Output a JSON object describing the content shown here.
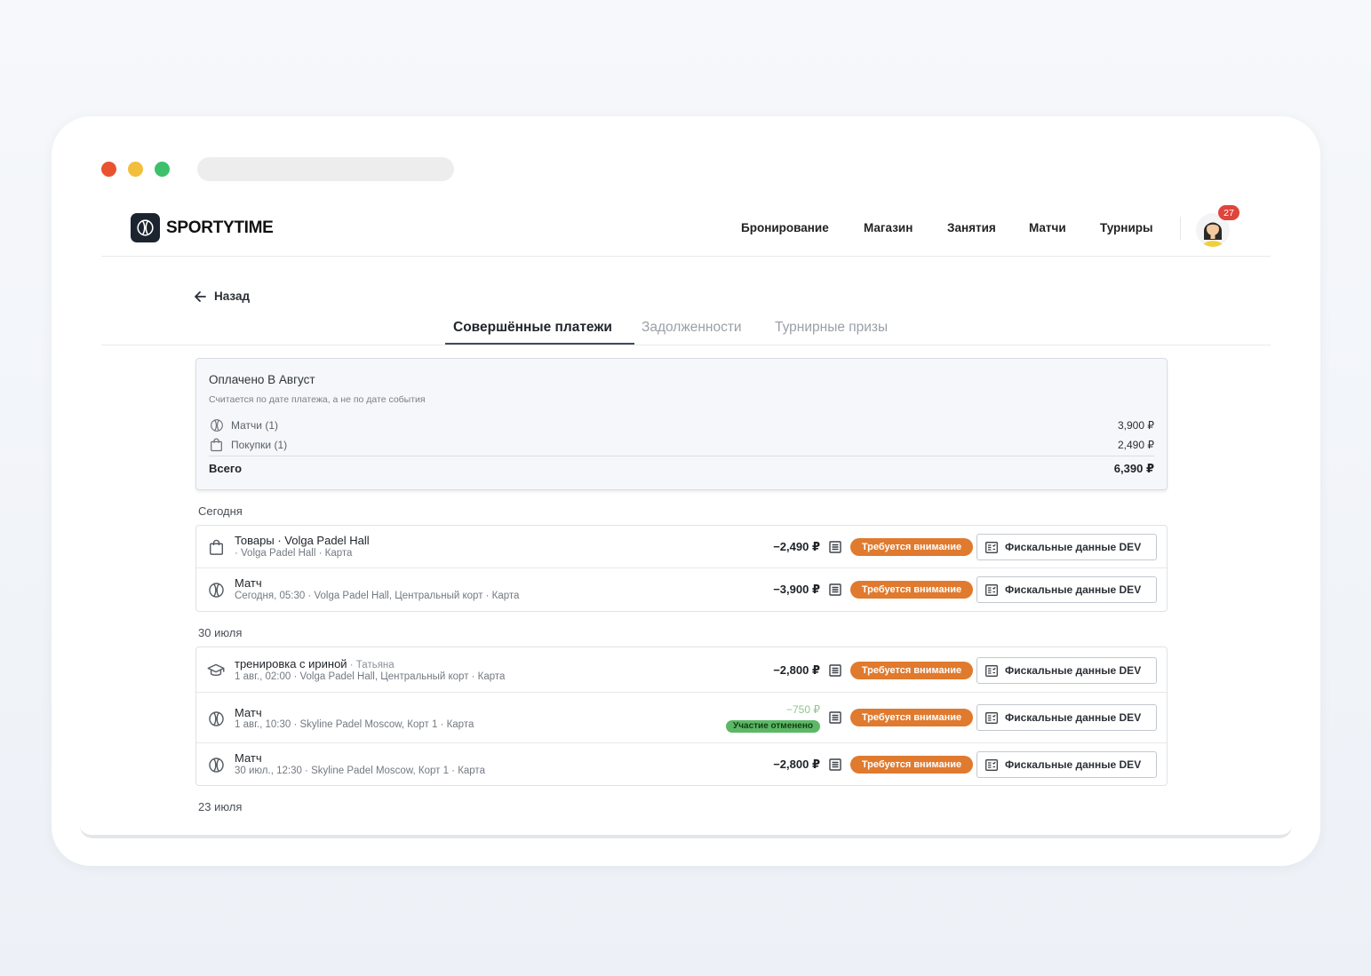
{
  "app": {
    "name": "SPORTYTIME"
  },
  "nav": {
    "items": [
      "Бронирование",
      "Магазин",
      "Занятия",
      "Матчи",
      "Турниры"
    ],
    "notifications_count": "27"
  },
  "back_label": "Назад",
  "tabs": [
    "Совершённые платежи",
    "Задолженности",
    "Турнирные призы"
  ],
  "summary": {
    "title": "Оплачено В Август",
    "subtitle": "Считается по дате платежа, а не по дате события",
    "rows": [
      {
        "label": "Матчи (1)",
        "amount": "3,900 ₽",
        "icon": "tennis-ball-icon"
      },
      {
        "label": "Покупки (1)",
        "amount": "2,490 ₽",
        "icon": "shopping-bag-icon"
      }
    ],
    "total_label": "Всего",
    "total_amount": "6,390 ₽"
  },
  "groups": [
    {
      "label": "Сегодня",
      "payments": [
        {
          "icon": "shopping-bag-icon",
          "title": "Товары · Volga Padel Hall",
          "who": "",
          "subtitle": "· Volga Padel Hall · Карта",
          "amount": "−2,490 ₽",
          "status": "Требуется внимание",
          "fiscal": "Фискальные данные DEV"
        },
        {
          "icon": "tennis-ball-icon",
          "title": "Матч",
          "who": "",
          "subtitle": "Сегодня, 05:30 · Volga Padel Hall, Центральный корт · Карта",
          "amount": "−3,900 ₽",
          "status": "Требуется внимание",
          "fiscal": "Фискальные данные DEV"
        }
      ]
    },
    {
      "label": "30 июля",
      "payments": [
        {
          "icon": "graduation-cap-icon",
          "title": "тренировка с ириной",
          "who": " · Татьяна",
          "subtitle": "1 авг., 02:00 · Volga Padel Hall, Центральный корт · Карта",
          "amount": "−2,800 ₽",
          "status": "Требуется внимание",
          "fiscal": "Фискальные данные DEV"
        },
        {
          "icon": "tennis-ball-icon",
          "title": "Матч",
          "who": "",
          "subtitle": "1 авг., 10:30 · Skyline Padel Moscow, Корт 1 · Карта",
          "amount": "−750 ₽",
          "cancelled_label": "Участие отменено",
          "status": "Требуется внимание",
          "fiscal": "Фискальные данные DEV"
        },
        {
          "icon": "tennis-ball-icon",
          "title": "Матч",
          "who": "",
          "subtitle": "30 июл., 12:30 · Skyline Padel Moscow, Корт 1 · Карта",
          "amount": "−2,800 ₽",
          "status": "Требуется внимание",
          "fiscal": "Фискальные данные DEV"
        }
      ]
    },
    {
      "label": "23 июля",
      "payments": []
    }
  ],
  "colors": {
    "attention": "#e07a2e",
    "cancelled": "#5cb866",
    "refund_amount": "#8fc58f",
    "tab_underline": "#3b4c63"
  }
}
